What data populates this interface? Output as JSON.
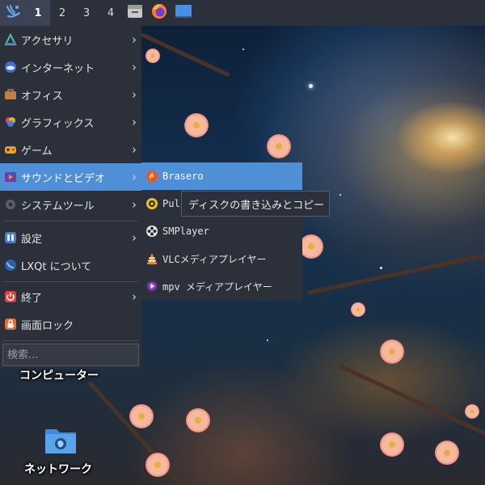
{
  "taskbar": {
    "workspaces": [
      "1",
      "2",
      "3",
      "4"
    ],
    "active_workspace": "1",
    "quicklaunch": [
      {
        "icon": "file-manager-icon"
      },
      {
        "icon": "firefox-icon"
      },
      {
        "icon": "desktop-icon"
      }
    ]
  },
  "main_menu": {
    "items": [
      {
        "label": "アクセサリ",
        "icon": "accessories-icon",
        "submenu": true
      },
      {
        "label": "インターネット",
        "icon": "internet-icon",
        "submenu": true
      },
      {
        "label": "オフィス",
        "icon": "office-icon",
        "submenu": true
      },
      {
        "label": "グラフィックス",
        "icon": "graphics-icon",
        "submenu": true
      },
      {
        "label": "ゲーム",
        "icon": "games-icon",
        "submenu": true
      },
      {
        "label": "サウンドとビデオ",
        "icon": "multimedia-icon",
        "submenu": true,
        "highlighted": true
      },
      {
        "label": "システムツール",
        "icon": "system-tools-icon",
        "submenu": true
      },
      {
        "label": "設定",
        "icon": "settings-icon",
        "submenu": true
      },
      {
        "label": "LXQt について",
        "icon": "lxqt-icon",
        "submenu": false
      },
      {
        "label": "終了",
        "icon": "power-icon",
        "submenu": true
      },
      {
        "label": "画面ロック",
        "icon": "lock-icon",
        "submenu": false
      }
    ],
    "search_placeholder": "検索..."
  },
  "submenu": {
    "items": [
      {
        "label": "Brasero",
        "icon": "brasero-icon",
        "highlighted": true
      },
      {
        "label": "Puls",
        "icon": "pulseaudio-icon"
      },
      {
        "label": "SMPlayer",
        "icon": "smplayer-icon"
      },
      {
        "label": "VLCメディアプレイヤー",
        "icon": "vlc-icon"
      },
      {
        "label": "mpv メディアプレイヤー",
        "icon": "mpv-icon"
      }
    ]
  },
  "tooltip": "ディスクの書き込みとコピー",
  "desktop": {
    "icons": [
      {
        "label": "コンピューター",
        "icon": "computer-icon"
      },
      {
        "label": "ネットワーク",
        "icon": "network-icon"
      }
    ]
  },
  "colors": {
    "panel_bg": "#2b303b",
    "highlight": "#4f8fd8",
    "accent_blue": "#3c8ad8"
  }
}
